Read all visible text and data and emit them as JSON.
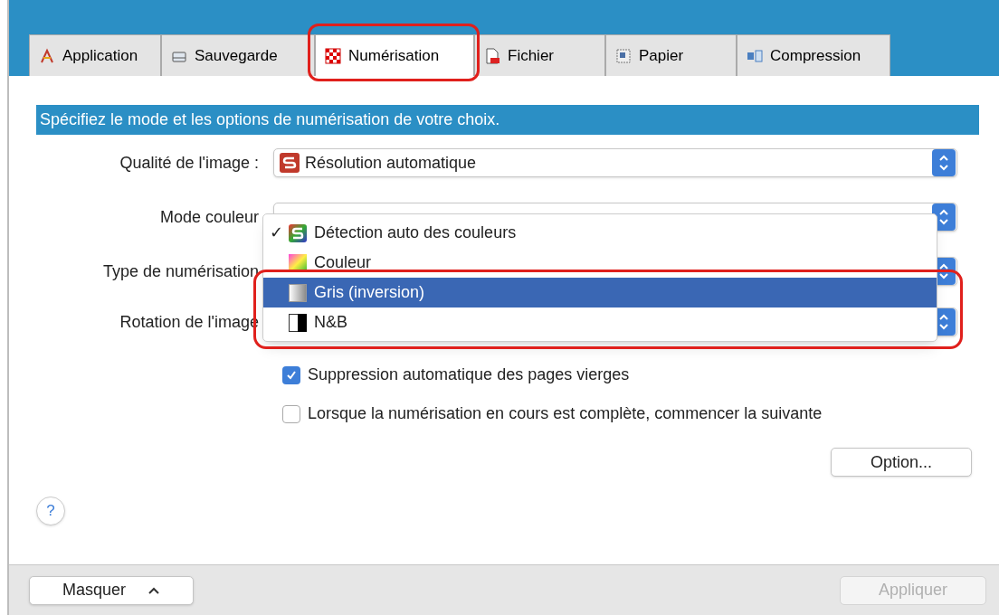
{
  "tabs": [
    {
      "label": "Application",
      "selected": false
    },
    {
      "label": "Sauvegarde",
      "selected": false
    },
    {
      "label": "Numérisation",
      "selected": true
    },
    {
      "label": "Fichier",
      "selected": false
    },
    {
      "label": "Papier",
      "selected": false
    },
    {
      "label": "Compression",
      "selected": false
    }
  ],
  "header": "Spécifiez le mode et les options de numérisation de votre choix.",
  "fields": [
    {
      "label": "Qualité de l'image :",
      "value": "Résolution automatique"
    },
    {
      "label": "Mode couleur"
    },
    {
      "label": "Type de numérisation"
    },
    {
      "label": "Rotation de l'image"
    }
  ],
  "menu": [
    {
      "label": "Détection auto des couleurs",
      "kind": "auto",
      "checked": true,
      "selected": false
    },
    {
      "label": "Couleur",
      "kind": "color",
      "checked": false,
      "selected": false
    },
    {
      "label": "Gris (inversion)",
      "kind": "gray",
      "checked": false,
      "selected": true
    },
    {
      "label": "N&B",
      "kind": "bw",
      "checked": false,
      "selected": false
    }
  ],
  "checkmark": "✓",
  "checkboxes": [
    {
      "label": "Suppression automatique des pages vierges",
      "checked": true
    },
    {
      "label": "Lorsque la numérisation en cours est complète, commencer la suivante",
      "checked": false
    }
  ],
  "option_button": "Option...",
  "help": "?",
  "hide_button": "Masquer",
  "apply_button": {
    "label": "Appliquer",
    "disabled": true
  }
}
